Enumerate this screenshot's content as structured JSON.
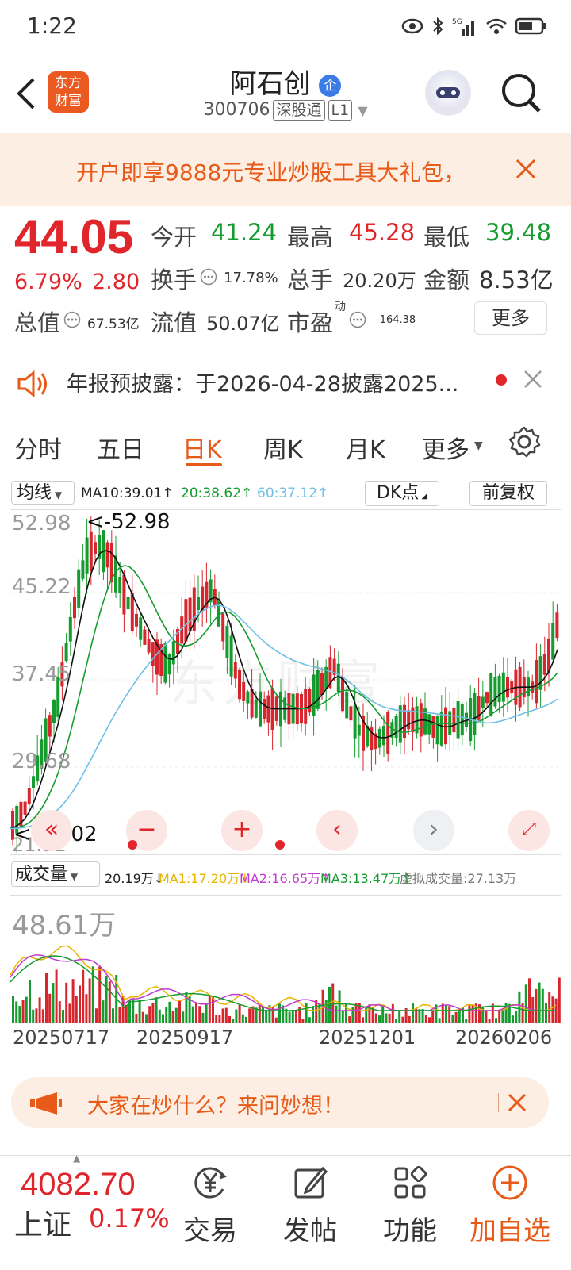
{
  "status_bar": {
    "time": "1:22"
  },
  "header": {
    "title": "阿石创",
    "code": "300706",
    "market_tag": "深股通",
    "level_tag": "L1",
    "logo_line1": "东方",
    "logo_line2": "财富",
    "badge": "企"
  },
  "banner": {
    "text": "开户即享9888元专业炒股工具大礼包，"
  },
  "quote": {
    "price": "44.05",
    "change_pct": "6.79%",
    "change": "2.80",
    "open_label": "今开",
    "open": "41.24",
    "high_label": "最高",
    "high": "45.28",
    "low_label": "最低",
    "low": "39.48",
    "turnover_label": "换手",
    "turnover": "17.78%",
    "volume_label": "总手",
    "volume": "20.20万",
    "amount_label": "金额",
    "amount": "8.53亿",
    "mktcap_label": "总值",
    "mktcap": "67.53亿",
    "float_label": "流值",
    "float_cap": "50.07亿",
    "pe_label": "市盈",
    "pe_sup": "动",
    "pe": "-164.38",
    "more_label": "更多"
  },
  "notice": {
    "text": "年报预披露：于2026-04-28披露2025..."
  },
  "tabs": [
    "分时",
    "五日",
    "日K",
    "周K",
    "月K",
    "更多"
  ],
  "active_tab": "日K",
  "ma_bar": {
    "selector": "均线",
    "ma10": "MA10:39.01↑",
    "ma20": "20:38.62↑",
    "ma60": "60:37.12↑",
    "dk": "DK点",
    "adjust": "前复权"
  },
  "kline": {
    "y_labels": [
      "52.98",
      "45.22",
      "37.45",
      "29.68",
      "21.92"
    ],
    "max_marker": "<-52.98",
    "min_marker": "<-24.02",
    "watermark": "东方财富"
  },
  "volume_bar": {
    "selector": "成交量",
    "vol": "20.19万↓",
    "ma1": "MA1:17.20万↓",
    "ma2": "MA2:16.65万↑",
    "ma3": "MA3:13.47万↑",
    "virtual": "虚拟成交量:27.13万"
  },
  "volume_chart": {
    "max_label": "48.61万",
    "dates": [
      "20250717",
      "20250917",
      "20251201",
      "20260206"
    ]
  },
  "promo": {
    "text": "大家在炒什么？来问妙想！"
  },
  "bottom_nav": {
    "index_value": "4082.70",
    "index_name": "上证",
    "index_pct": "0.17%",
    "trade": "交易",
    "post": "发帖",
    "function": "功能",
    "add_watch": "加自选"
  },
  "colors": {
    "up": "#e0262b",
    "down": "#169c2e",
    "accent": "#e85a18",
    "ma10": "#111111",
    "ma20": "#169c2e",
    "ma60": "#6fbfe6"
  }
}
